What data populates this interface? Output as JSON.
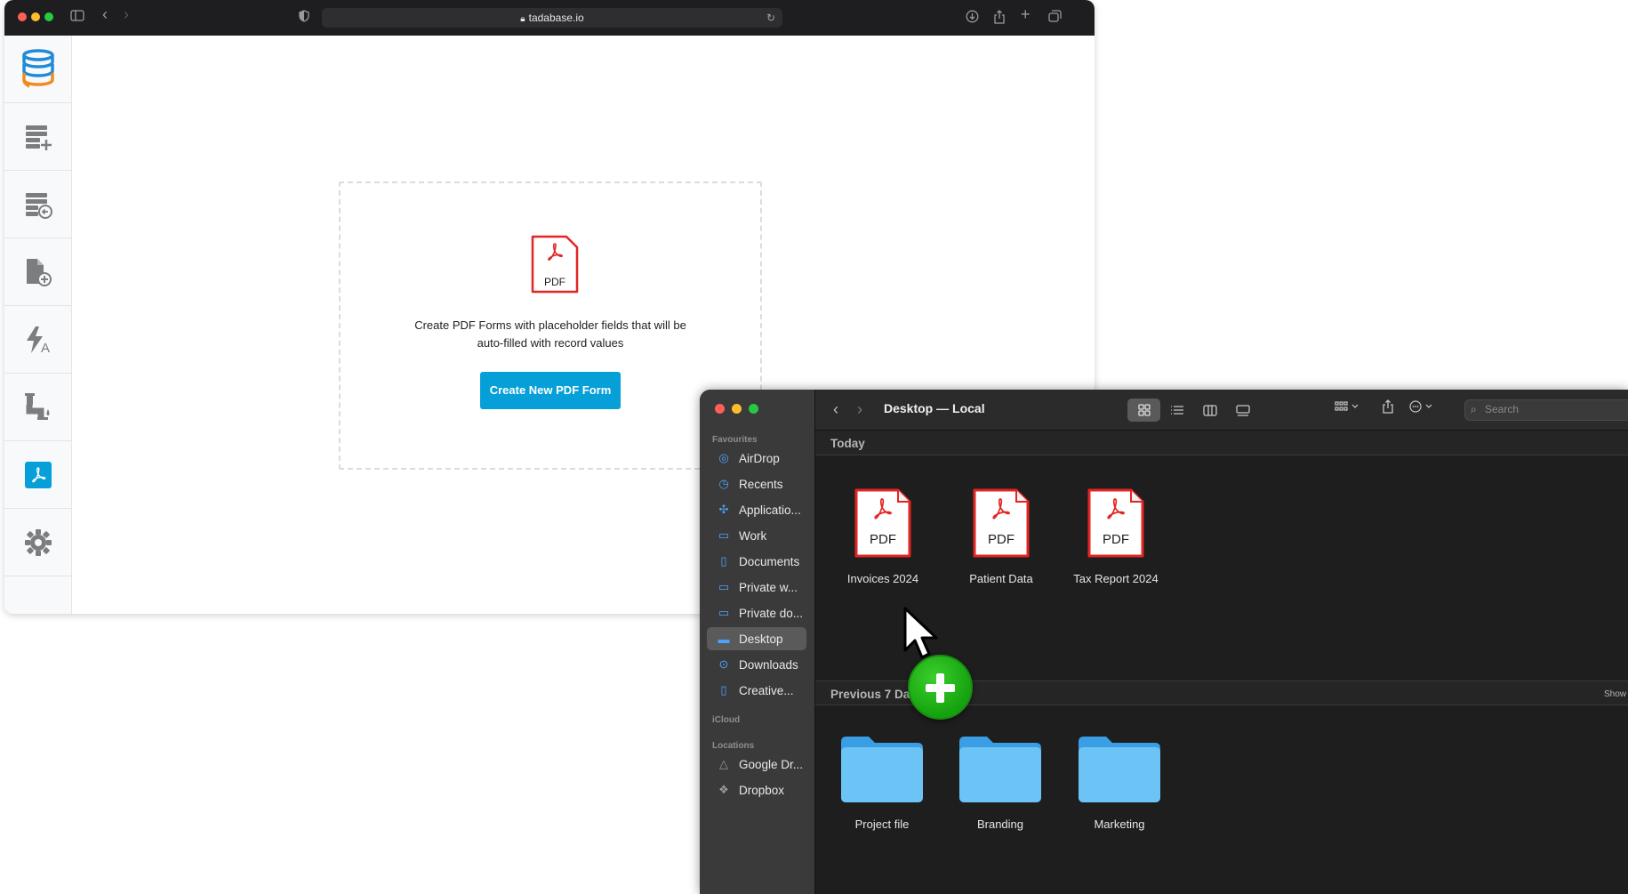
{
  "browser": {
    "url": "tadabase.io",
    "sidebar_icons": [
      "database-logo-icon",
      "table-add-icon",
      "table-import-icon",
      "file-add-icon",
      "automation-icon",
      "pipes-icon",
      "pdf-icon",
      "settings-gear-icon"
    ]
  },
  "pdf_forms": {
    "badge_label": "PDF",
    "description_line1": "Create PDF Forms with placeholder fields that will be",
    "description_line2": "auto-filled with record values",
    "create_button": "Create New PDF Form"
  },
  "finder": {
    "title": "Desktop — Local",
    "search_placeholder": "Search",
    "sidebar": {
      "favourites_label": "Favourites",
      "favourites": [
        {
          "label": "AirDrop",
          "icon": "airdrop-icon"
        },
        {
          "label": "Recents",
          "icon": "clock-icon"
        },
        {
          "label": "Applicatio...",
          "icon": "applications-icon"
        },
        {
          "label": "Work",
          "icon": "folder-icon"
        },
        {
          "label": "Documents",
          "icon": "document-icon"
        },
        {
          "label": "Private w...",
          "icon": "folder-icon"
        },
        {
          "label": "Private do...",
          "icon": "folder-icon"
        },
        {
          "label": "Desktop",
          "icon": "desktop-icon"
        },
        {
          "label": "Downloads",
          "icon": "download-icon"
        },
        {
          "label": "Creative...",
          "icon": "document-icon"
        }
      ],
      "icloud_label": "iCloud",
      "locations_label": "Locations",
      "locations": [
        {
          "label": "Google Dr...",
          "icon": "drive-icon"
        },
        {
          "label": "Dropbox",
          "icon": "dropbox-icon"
        }
      ]
    },
    "sections": {
      "today": "Today",
      "previous": "Previous 7 Days",
      "show": "Show"
    },
    "today_files": [
      {
        "name": "Invoices 2024",
        "badge": "PDF"
      },
      {
        "name": "Patient Data",
        "badge": "PDF"
      },
      {
        "name": "Tax Report 2024",
        "badge": "PDF"
      }
    ],
    "previous_folders": [
      {
        "name": "Project file"
      },
      {
        "name": "Branding"
      },
      {
        "name": "Marketing"
      }
    ]
  },
  "colors": {
    "accent_blue": "#069fd8",
    "pdf_red": "#e32524",
    "folder_blue": "#5fb8f0",
    "finder_bg": "#1e1e1e"
  }
}
